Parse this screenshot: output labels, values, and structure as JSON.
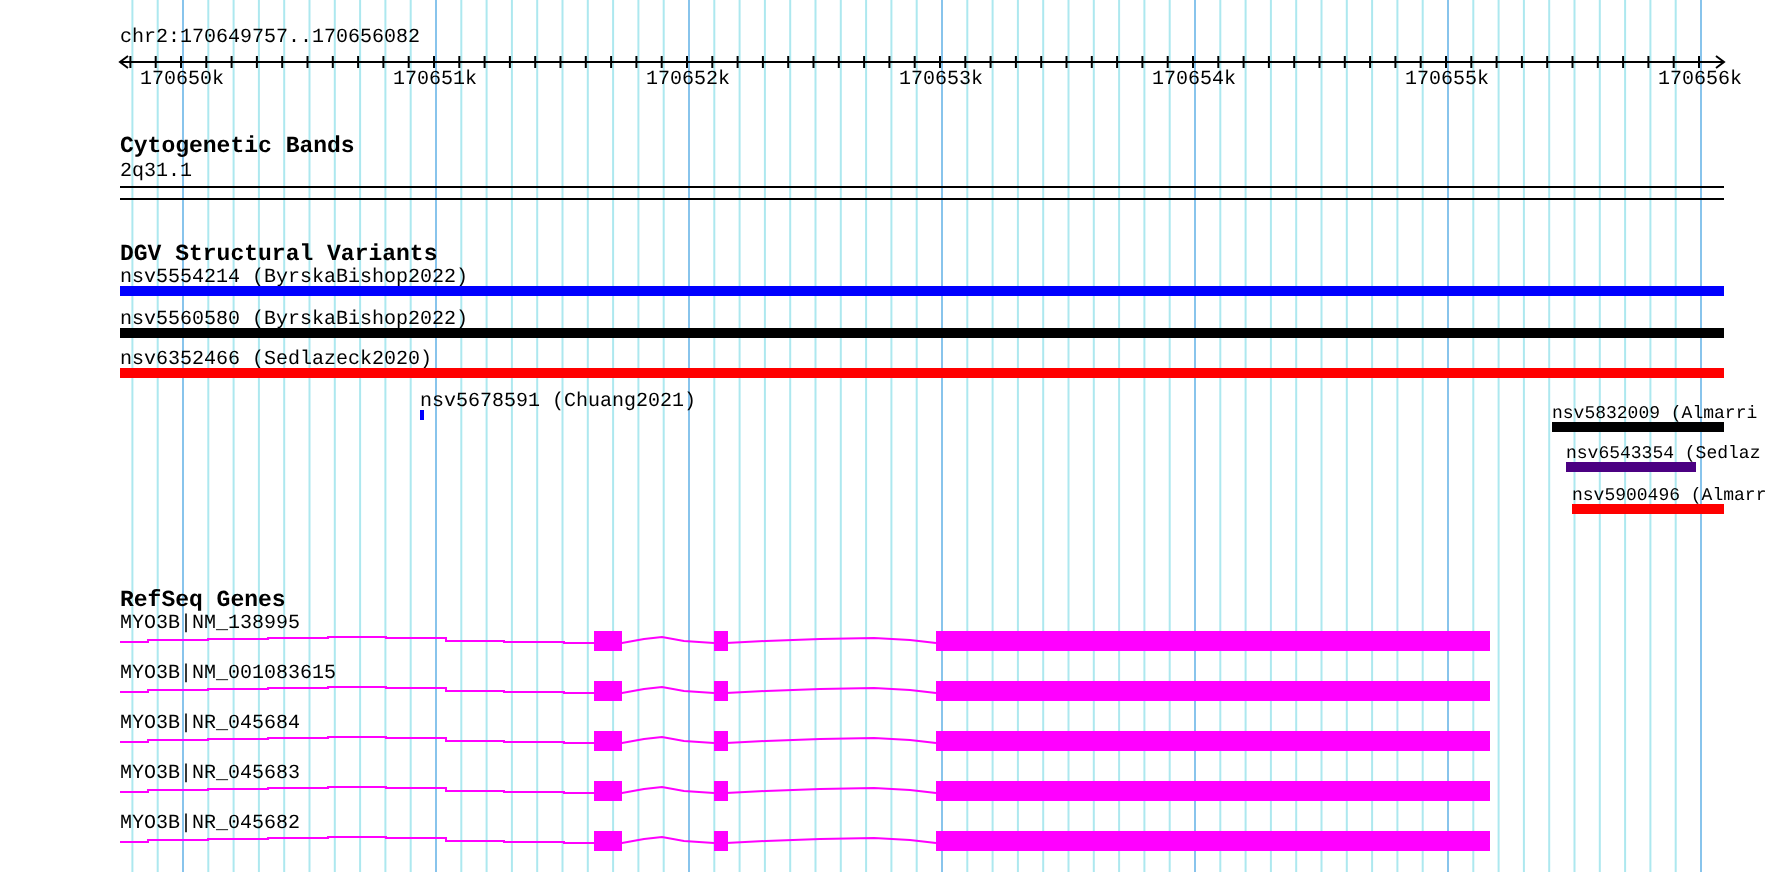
{
  "location": "chr2:170649757..170656082",
  "ruler": {
    "ticks": [
      "170650k",
      "170651k",
      "170652k",
      "170653k",
      "170654k",
      "170655k",
      "170656k"
    ]
  },
  "tracks": [
    {
      "kind": "bands",
      "title": "Cytogenetic Bands",
      "features": [
        {
          "label": "2q31.1"
        }
      ]
    },
    {
      "kind": "variants",
      "title": "DGV Structural Variants",
      "features": [
        {
          "label": "nsv5554214 (ByrskaBishop2022)",
          "color": "#0000ff"
        },
        {
          "label": "nsv5560580 (ByrskaBishop2022)",
          "color": "#000000"
        },
        {
          "label": "nsv6352466 (Sedlazeck2020)",
          "color": "#ff0000"
        },
        {
          "label": "nsv5678591 (Chuang2021)",
          "color": "#0000fe"
        },
        {
          "label": "nsv5832009 (Almarri",
          "color": "#000001"
        },
        {
          "label": "nsv6543354 (Sedlaz",
          "color": "#4b0082"
        },
        {
          "label": "nsv5900496 (Almarr",
          "color": "#fe0000"
        }
      ]
    },
    {
      "kind": "genes",
      "title": "RefSeq Genes",
      "features": [
        {
          "label": "MYO3B|NM_138995"
        },
        {
          "label": "MYO3B|NM_001083615"
        },
        {
          "label": "MYO3B|NR_045684"
        },
        {
          "label": "MYO3B|NR_045683"
        },
        {
          "label": "MYO3B|NR_045682"
        }
      ]
    }
  ]
}
